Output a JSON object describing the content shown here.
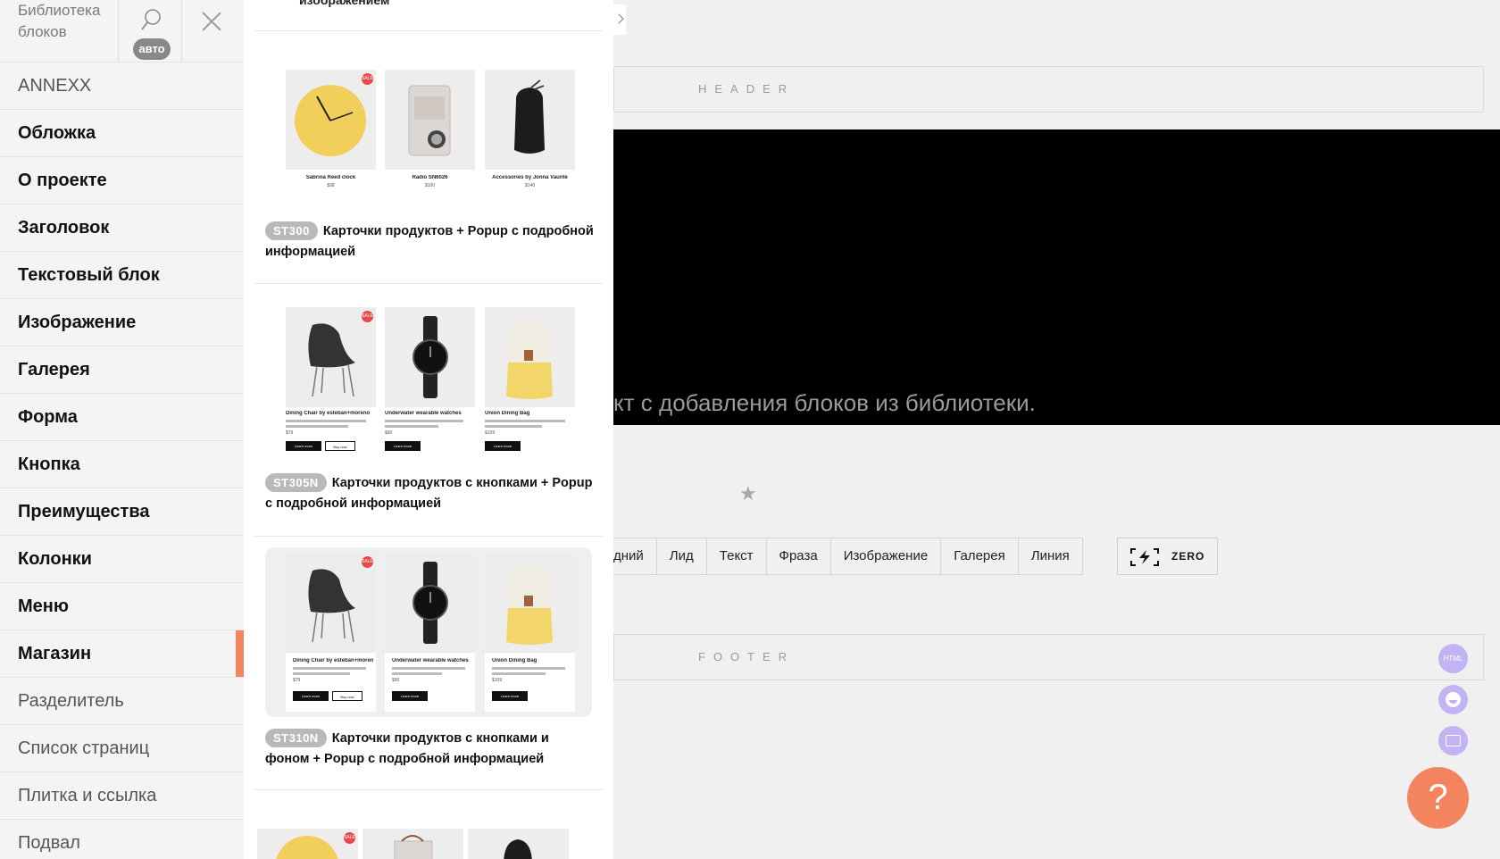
{
  "sidebar": {
    "title": "Библиотека блоков",
    "search_badge": "авто",
    "items": [
      {
        "label": "ANNEXX",
        "style": "light"
      },
      {
        "label": "Обложка",
        "style": "bold"
      },
      {
        "label": "О проекте",
        "style": "bold"
      },
      {
        "label": "Заголовок",
        "style": "bold"
      },
      {
        "label": "Текстовый блок",
        "style": "bold"
      },
      {
        "label": "Изображение",
        "style": "bold"
      },
      {
        "label": "Галерея",
        "style": "bold"
      },
      {
        "label": "Форма",
        "style": "bold"
      },
      {
        "label": "Кнопка",
        "style": "bold"
      },
      {
        "label": "Преимущества",
        "style": "bold"
      },
      {
        "label": "Колонки",
        "style": "bold"
      },
      {
        "label": "Меню",
        "style": "bold"
      },
      {
        "label": "Магазин",
        "style": "bold",
        "active": true
      },
      {
        "label": "Разделитель",
        "style": "light"
      },
      {
        "label": "Список страниц",
        "style": "light"
      },
      {
        "label": "Плитка и ссылка",
        "style": "light"
      },
      {
        "label": "Подвал",
        "style": "light"
      }
    ]
  },
  "panel": {
    "top_text": "изображением",
    "cards": [
      {
        "code": "ST300",
        "title": "Карточки продуктов + Popup с подробной информацией",
        "products": [
          {
            "name": "Sabrina Reed clock",
            "price": "$98"
          },
          {
            "name": "Radio SN6026",
            "price": "$100"
          },
          {
            "name": "Accessories by Jonna Vaunte",
            "price": "$140"
          }
        ]
      },
      {
        "code": "ST305N",
        "title": "Карточки продуктов с кнопками + Popup с подробной информацией",
        "products": [
          {
            "name": "Dining Chair by esteban+moreno",
            "price": "$79",
            "btn1": "Learn more",
            "btn2": "Buy now"
          },
          {
            "name": "Underwater wearable watches",
            "price": "$90",
            "btn1": "Learn more"
          },
          {
            "name": "Union Dining Bag",
            "price": "$109",
            "btn1": "Learn more"
          }
        ]
      },
      {
        "code": "ST310N",
        "title": "Карточки продуктов с кнопками и фоном + Popup с подробной информацией",
        "products": [
          {
            "name": "Dining Chair by esteban+moreno",
            "price": "$79",
            "btn1": "Learn more",
            "btn2": "Buy now"
          },
          {
            "name": "Underwater wearable watches",
            "price": "$90",
            "btn1": "Learn more"
          },
          {
            "name": "Union Dining Bag",
            "price": "$109",
            "btn1": "Learn more"
          }
        ]
      }
    ]
  },
  "canvas": {
    "header_label": "HEADER",
    "footer_label": "FOOTER",
    "cover_text": "кт с добавления блоков из библиотеки.",
    "quick_blocks": [
      "дний",
      "Лид",
      "Текст",
      "Фраза",
      "Изображение",
      "Галерея",
      "Линия"
    ],
    "zero_label": "ZERO",
    "side_buttons": {
      "html": "HTML"
    },
    "help_label": "?"
  },
  "colors": {
    "accent": "#f4845f",
    "assistant": "#c2b4f4",
    "sale": "#e84a4a"
  }
}
